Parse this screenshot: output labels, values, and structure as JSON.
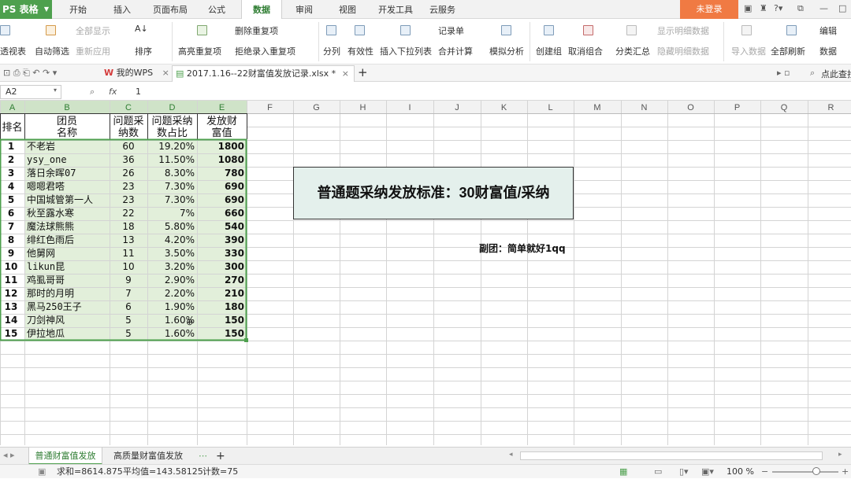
{
  "app": {
    "logo": "PS 表格",
    "login": "未登录"
  },
  "menu": {
    "tabs": [
      "开始",
      "插入",
      "页面布局",
      "公式",
      "数据",
      "审阅",
      "视图",
      "开发工具",
      "云服务"
    ],
    "active": 4
  },
  "toolbar": {
    "pivot": "透视表",
    "autofilter": "自动筛选",
    "show_all": "全部显示",
    "reapply": "重新应用",
    "sort": "排序",
    "highlight_dup": "高亮重复项",
    "del_dup": "删除重复项",
    "reject_dup": "拒绝录入重复项",
    "split": "分列",
    "validity": "有效性",
    "dropdown": "插入下拉列表",
    "record": "记录单",
    "consolidate": "合并计算",
    "simulate": "模拟分析",
    "group": "创建组",
    "ungroup": "取消组合",
    "subtotal": "分类汇总",
    "show_detail": "显示明细数据",
    "hide_detail": "隐藏明细数据",
    "import": "导入数据",
    "refresh_all": "全部刷新",
    "edit": "编辑",
    "data_link": "数据"
  },
  "tabs": {
    "home": "我的WPS",
    "file": "2017.1.16--22财富值发放记录.xlsx *",
    "search": "点此查找"
  },
  "formula": {
    "cell_ref": "A2",
    "fx": "fx",
    "value": "1"
  },
  "grid": {
    "columns": [
      "A",
      "B",
      "C",
      "D",
      "E",
      "F",
      "G",
      "H",
      "I",
      "J",
      "K",
      "L",
      "M",
      "N",
      "O",
      "P",
      "Q",
      "R"
    ],
    "headers": {
      "rank": "排名",
      "name": "团员名称",
      "count": "问题采纳数",
      "pct": "问题采纳数占比",
      "wealth": "发放财富值"
    },
    "rows": [
      {
        "rank": "1",
        "name": "不老岩",
        "count": "60",
        "pct": "19.20%",
        "wealth": "1800"
      },
      {
        "rank": "2",
        "name": "ysy_one",
        "count": "36",
        "pct": "11.50%",
        "wealth": "1080"
      },
      {
        "rank": "3",
        "name": "落日余晖07",
        "count": "26",
        "pct": "8.30%",
        "wealth": "780"
      },
      {
        "rank": "4",
        "name": "嗯嗯君嗒",
        "count": "23",
        "pct": "7.30%",
        "wealth": "690"
      },
      {
        "rank": "5",
        "name": "中国城管第一人",
        "count": "23",
        "pct": "7.30%",
        "wealth": "690"
      },
      {
        "rank": "6",
        "name": "秋至露水寒",
        "count": "22",
        "pct": "7%",
        "wealth": "660"
      },
      {
        "rank": "7",
        "name": "魔法球熊熊",
        "count": "18",
        "pct": "5.80%",
        "wealth": "540"
      },
      {
        "rank": "8",
        "name": "绯红色雨后",
        "count": "13",
        "pct": "4.20%",
        "wealth": "390"
      },
      {
        "rank": "9",
        "name": "他舅网",
        "count": "11",
        "pct": "3.50%",
        "wealth": "330"
      },
      {
        "rank": "10",
        "name": "likun昆",
        "count": "10",
        "pct": "3.20%",
        "wealth": "300"
      },
      {
        "rank": "11",
        "name": "鸡虱哥哥",
        "count": "9",
        "pct": "2.90%",
        "wealth": "270"
      },
      {
        "rank": "12",
        "name": "那时的月明",
        "count": "7",
        "pct": "2.20%",
        "wealth": "210"
      },
      {
        "rank": "13",
        "name": "黑马250王子",
        "count": "6",
        "pct": "1.90%",
        "wealth": "180"
      },
      {
        "rank": "14",
        "name": "刀剑神风",
        "count": "5",
        "pct": "1.60%",
        "wealth": "150"
      },
      {
        "rank": "15",
        "name": "伊拉地瓜",
        "count": "5",
        "pct": "1.60%",
        "wealth": "150"
      }
    ],
    "banner": "普通题采纳发放标准：30财富值/采纳",
    "note": "副团：简单就好1qq"
  },
  "sheets": {
    "tabs": [
      "普通财富值发放",
      "高质量财富值发放"
    ],
    "active": 0,
    "more": "⋯",
    "add": "+"
  },
  "status": {
    "sum": "求和=8614.875",
    "avg": "平均值=143.58125",
    "count": "计数=75",
    "zoom": "100 %"
  },
  "colors": {
    "accent": "#4ea04e",
    "login": "#f07a43",
    "selected_fill": "#e2efda",
    "banner_fill": "#e4f0ec"
  }
}
